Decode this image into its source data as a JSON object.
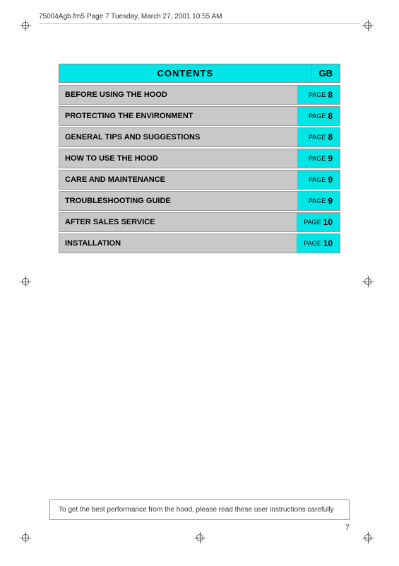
{
  "header": {
    "file_info": "75004Agb.fm5  Page 7  Tuesday, March 27, 2001  10:55 AM"
  },
  "contents": {
    "title": "CONTENTS",
    "gb_label": "GB",
    "rows": [
      {
        "label": "BEFORE USING THE HOOD",
        "page_word": "PAGE",
        "page_num": "8"
      },
      {
        "label": "PROTECTING THE ENVIRONMENT",
        "page_word": "PAGE",
        "page_num": "8"
      },
      {
        "label": "GENERAL TIPS AND SUGGESTIONS",
        "page_word": "PAGE",
        "page_num": "8"
      },
      {
        "label": "HOW TO USE THE HOOD",
        "page_word": "PAGE",
        "page_num": "9"
      },
      {
        "label": "CARE AND MAINTENANCE",
        "page_word": "PAGE",
        "page_num": "9"
      },
      {
        "label": "TROUBLESHOOTING GUIDE",
        "page_word": "PAGE",
        "page_num": "9"
      },
      {
        "label": "AFTER SALES SERVICE",
        "page_word": "PAGE",
        "page_num": "10"
      },
      {
        "label": "INSTALLATION",
        "page_word": "PAGE",
        "page_num": "10"
      }
    ]
  },
  "footer": {
    "note": "To get the best performance from the hood, please read these user instructions carefully"
  },
  "page_number": "7"
}
